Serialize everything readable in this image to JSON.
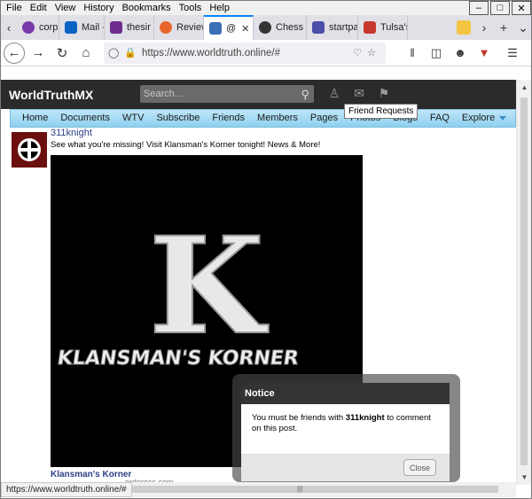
{
  "menu": [
    "File",
    "Edit",
    "View",
    "History",
    "Bookmarks",
    "Tools",
    "Help"
  ],
  "tabs": [
    {
      "label": "corpu",
      "color": "#7a3ba8",
      "icon": "peace-icon"
    },
    {
      "label": "Mail -",
      "color": "#0b63c4",
      "icon": "outlook-icon"
    },
    {
      "label": "thesir",
      "color": "#6e2d8e",
      "icon": "mail-icon"
    },
    {
      "label": "Review",
      "color": "#e8652b",
      "icon": "star-icon"
    },
    {
      "label": "@",
      "color": "#3b6fb6",
      "icon": "site-icon",
      "active": true
    },
    {
      "label": "Chess",
      "color": "#333333",
      "icon": "knight-icon"
    },
    {
      "label": "startpa",
      "color": "#4b4fa8",
      "icon": "startpage-icon"
    },
    {
      "label": "Tulsa's",
      "color": "#c8372d",
      "icon": "bookmark-icon"
    }
  ],
  "url": "https://www.worldtruth.online/#",
  "site": {
    "name": "WorldTruthMX",
    "search_placeholder": "Search...",
    "tooltip": "Friend Requests",
    "nav": [
      "Home",
      "Documents",
      "WTV",
      "Subscribe",
      "Friends",
      "Members",
      "Pages",
      "Photos",
      "Blogs",
      "FAQ",
      "Explore"
    ]
  },
  "post": {
    "user": "311knight",
    "text": "See what you're missing! Visit Klansman's Korner tonight! News & More!",
    "image_letter": "K",
    "image_text": "KLANSMAN'S KORNER",
    "caption": "Klansman's Korner",
    "domain": "ordeross.com"
  },
  "notice": {
    "title": "Notice",
    "msg_pre": "You must be friends with ",
    "msg_user": "311knight",
    "msg_post": " to comment on this post.",
    "close": "Close"
  },
  "status": "https://www.worldtruth.online/#"
}
